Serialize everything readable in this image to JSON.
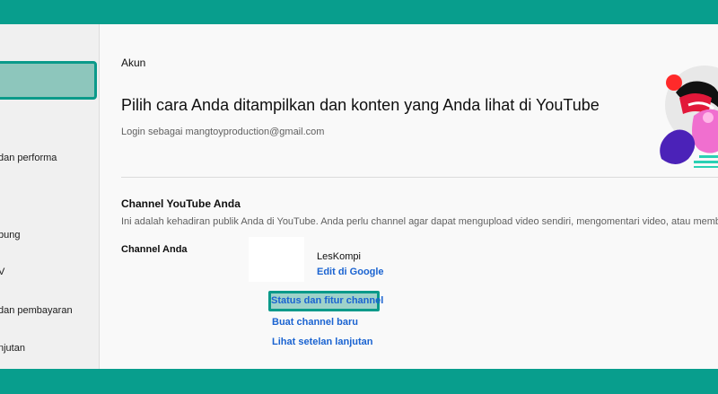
{
  "sidebar": {
    "items": [
      {
        "label": "dan performa"
      },
      {
        "label": "bung"
      },
      {
        "label": "V"
      },
      {
        "label": "dan pembayaran"
      },
      {
        "label": "njutan"
      }
    ]
  },
  "main": {
    "section_label": "Akun",
    "headline": "Pilih cara Anda ditampilkan dan konten yang Anda lihat di YouTube",
    "login_text": "Login sebagai mangtoyproduction@gmail.com",
    "channel_section": {
      "title": "Channel YouTube Anda",
      "description": "Ini adalah kehadiran publik Anda di YouTube. Anda perlu channel agar dapat mengupload video sendiri, mengomentari video, atau membuat p",
      "label": "Channel Anda",
      "channel_name": "LesKompi",
      "edit_link": "Edit di Google",
      "status_link": "Status dan fitur channel",
      "create_link": "Buat channel baru",
      "advanced_link": "Lihat setelan lanjutan"
    }
  },
  "colors": {
    "frame": "#089e8d",
    "link": "#1a63d1",
    "highlight_border": "#0a9a8a"
  }
}
